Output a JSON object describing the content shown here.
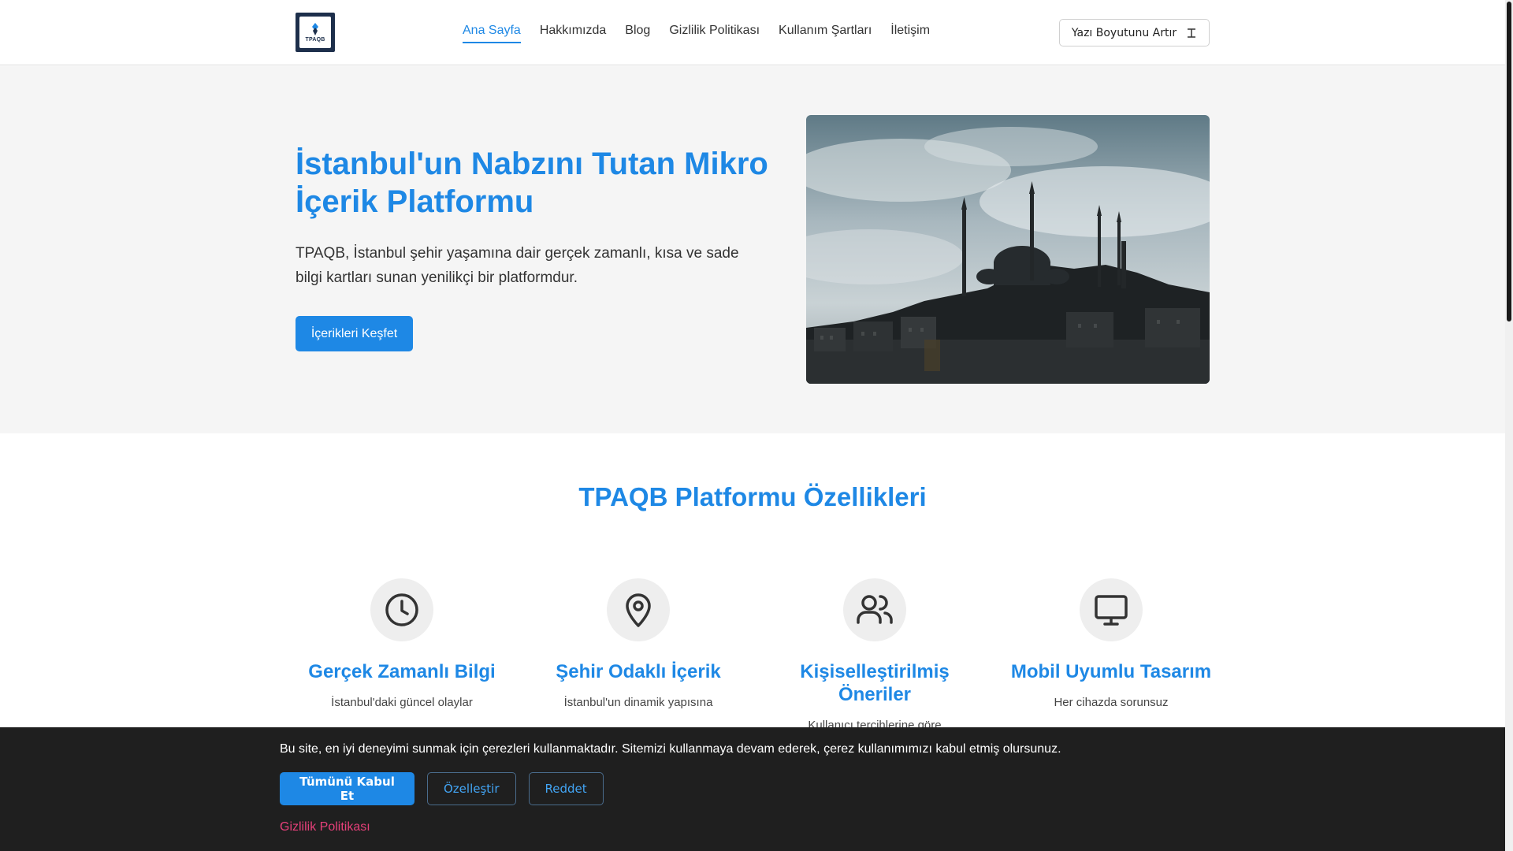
{
  "header": {
    "logo_text": "TPAQB",
    "nav": [
      {
        "label": "Ana Sayfa",
        "active": true
      },
      {
        "label": "Hakkımızda",
        "active": false
      },
      {
        "label": "Blog",
        "active": false
      },
      {
        "label": "Gizlilik Politikası",
        "active": false
      },
      {
        "label": "Kullanım Şartları",
        "active": false
      },
      {
        "label": "İletişim",
        "active": false
      }
    ],
    "font_size_button": "Yazı Boyutunu Artır",
    "font_size_icon": "text-size-icon"
  },
  "hero": {
    "title": "İstanbul'un Nabzını Tutan Mikro İçerik Platformu",
    "description": "TPAQB, İstanbul şehir yaşamına dair gerçek zamanlı, kısa ve sade bilgi kartları sunan yenilikçi bir platformdur.",
    "cta": "İçerikleri Keşfet"
  },
  "features": {
    "title": "TPAQB Platformu Özellikleri",
    "items": [
      {
        "icon": "clock-icon",
        "title": "Gerçek Zamanlı Bilgi",
        "desc": "İstanbul'daki güncel olaylar"
      },
      {
        "icon": "map-pin-icon",
        "title": "Şehir Odaklı İçerik",
        "desc": "İstanbul'un dinamik yapısına"
      },
      {
        "icon": "users-icon",
        "title": "Kişiselleştirilmiş Öneriler",
        "desc": "Kullanıcı tercihlerine göre"
      },
      {
        "icon": "monitor-icon",
        "title": "Mobil Uyumlu Tasarım",
        "desc": "Her cihazda sorunsuz"
      }
    ]
  },
  "cookie": {
    "text": "Bu site, en iyi deneyimi sunmak için çerezleri kullanmaktadır. Sitemizi kullanmaya devam ederek, çerez kullanımımızı kabul etmiş olursunuz.",
    "accept": "Tümünü Kabul Et",
    "customize": "Özelleştir",
    "reject": "Reddet",
    "privacy_link": "Gizlilik Politikası"
  },
  "colors": {
    "accent": "#1e88e5",
    "logo_bg": "#1d2f4b",
    "cookie_bg": "#1f1f1f",
    "privacy_link": "#e6407a"
  }
}
